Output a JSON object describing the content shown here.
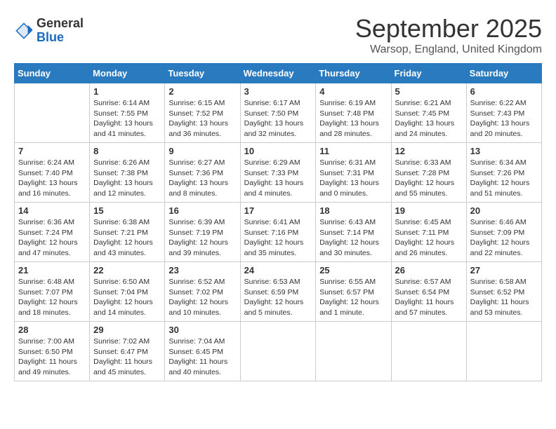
{
  "logo": {
    "general": "General",
    "blue": "Blue"
  },
  "title": "September 2025",
  "subtitle": "Warsop, England, United Kingdom",
  "weekdays": [
    "Sunday",
    "Monday",
    "Tuesday",
    "Wednesday",
    "Thursday",
    "Friday",
    "Saturday"
  ],
  "weeks": [
    [
      {
        "day": "",
        "info": ""
      },
      {
        "day": "1",
        "info": "Sunrise: 6:14 AM\nSunset: 7:55 PM\nDaylight: 13 hours\nand 41 minutes."
      },
      {
        "day": "2",
        "info": "Sunrise: 6:15 AM\nSunset: 7:52 PM\nDaylight: 13 hours\nand 36 minutes."
      },
      {
        "day": "3",
        "info": "Sunrise: 6:17 AM\nSunset: 7:50 PM\nDaylight: 13 hours\nand 32 minutes."
      },
      {
        "day": "4",
        "info": "Sunrise: 6:19 AM\nSunset: 7:48 PM\nDaylight: 13 hours\nand 28 minutes."
      },
      {
        "day": "5",
        "info": "Sunrise: 6:21 AM\nSunset: 7:45 PM\nDaylight: 13 hours\nand 24 minutes."
      },
      {
        "day": "6",
        "info": "Sunrise: 6:22 AM\nSunset: 7:43 PM\nDaylight: 13 hours\nand 20 minutes."
      }
    ],
    [
      {
        "day": "7",
        "info": "Sunrise: 6:24 AM\nSunset: 7:40 PM\nDaylight: 13 hours\nand 16 minutes."
      },
      {
        "day": "8",
        "info": "Sunrise: 6:26 AM\nSunset: 7:38 PM\nDaylight: 13 hours\nand 12 minutes."
      },
      {
        "day": "9",
        "info": "Sunrise: 6:27 AM\nSunset: 7:36 PM\nDaylight: 13 hours\nand 8 minutes."
      },
      {
        "day": "10",
        "info": "Sunrise: 6:29 AM\nSunset: 7:33 PM\nDaylight: 13 hours\nand 4 minutes."
      },
      {
        "day": "11",
        "info": "Sunrise: 6:31 AM\nSunset: 7:31 PM\nDaylight: 13 hours\nand 0 minutes."
      },
      {
        "day": "12",
        "info": "Sunrise: 6:33 AM\nSunset: 7:28 PM\nDaylight: 12 hours\nand 55 minutes."
      },
      {
        "day": "13",
        "info": "Sunrise: 6:34 AM\nSunset: 7:26 PM\nDaylight: 12 hours\nand 51 minutes."
      }
    ],
    [
      {
        "day": "14",
        "info": "Sunrise: 6:36 AM\nSunset: 7:24 PM\nDaylight: 12 hours\nand 47 minutes."
      },
      {
        "day": "15",
        "info": "Sunrise: 6:38 AM\nSunset: 7:21 PM\nDaylight: 12 hours\nand 43 minutes."
      },
      {
        "day": "16",
        "info": "Sunrise: 6:39 AM\nSunset: 7:19 PM\nDaylight: 12 hours\nand 39 minutes."
      },
      {
        "day": "17",
        "info": "Sunrise: 6:41 AM\nSunset: 7:16 PM\nDaylight: 12 hours\nand 35 minutes."
      },
      {
        "day": "18",
        "info": "Sunrise: 6:43 AM\nSunset: 7:14 PM\nDaylight: 12 hours\nand 30 minutes."
      },
      {
        "day": "19",
        "info": "Sunrise: 6:45 AM\nSunset: 7:11 PM\nDaylight: 12 hours\nand 26 minutes."
      },
      {
        "day": "20",
        "info": "Sunrise: 6:46 AM\nSunset: 7:09 PM\nDaylight: 12 hours\nand 22 minutes."
      }
    ],
    [
      {
        "day": "21",
        "info": "Sunrise: 6:48 AM\nSunset: 7:07 PM\nDaylight: 12 hours\nand 18 minutes."
      },
      {
        "day": "22",
        "info": "Sunrise: 6:50 AM\nSunset: 7:04 PM\nDaylight: 12 hours\nand 14 minutes."
      },
      {
        "day": "23",
        "info": "Sunrise: 6:52 AM\nSunset: 7:02 PM\nDaylight: 12 hours\nand 10 minutes."
      },
      {
        "day": "24",
        "info": "Sunrise: 6:53 AM\nSunset: 6:59 PM\nDaylight: 12 hours\nand 5 minutes."
      },
      {
        "day": "25",
        "info": "Sunrise: 6:55 AM\nSunset: 6:57 PM\nDaylight: 12 hours\nand 1 minute."
      },
      {
        "day": "26",
        "info": "Sunrise: 6:57 AM\nSunset: 6:54 PM\nDaylight: 11 hours\nand 57 minutes."
      },
      {
        "day": "27",
        "info": "Sunrise: 6:58 AM\nSunset: 6:52 PM\nDaylight: 11 hours\nand 53 minutes."
      }
    ],
    [
      {
        "day": "28",
        "info": "Sunrise: 7:00 AM\nSunset: 6:50 PM\nDaylight: 11 hours\nand 49 minutes."
      },
      {
        "day": "29",
        "info": "Sunrise: 7:02 AM\nSunset: 6:47 PM\nDaylight: 11 hours\nand 45 minutes."
      },
      {
        "day": "30",
        "info": "Sunrise: 7:04 AM\nSunset: 6:45 PM\nDaylight: 11 hours\nand 40 minutes."
      },
      {
        "day": "",
        "info": ""
      },
      {
        "day": "",
        "info": ""
      },
      {
        "day": "",
        "info": ""
      },
      {
        "day": "",
        "info": ""
      }
    ]
  ]
}
